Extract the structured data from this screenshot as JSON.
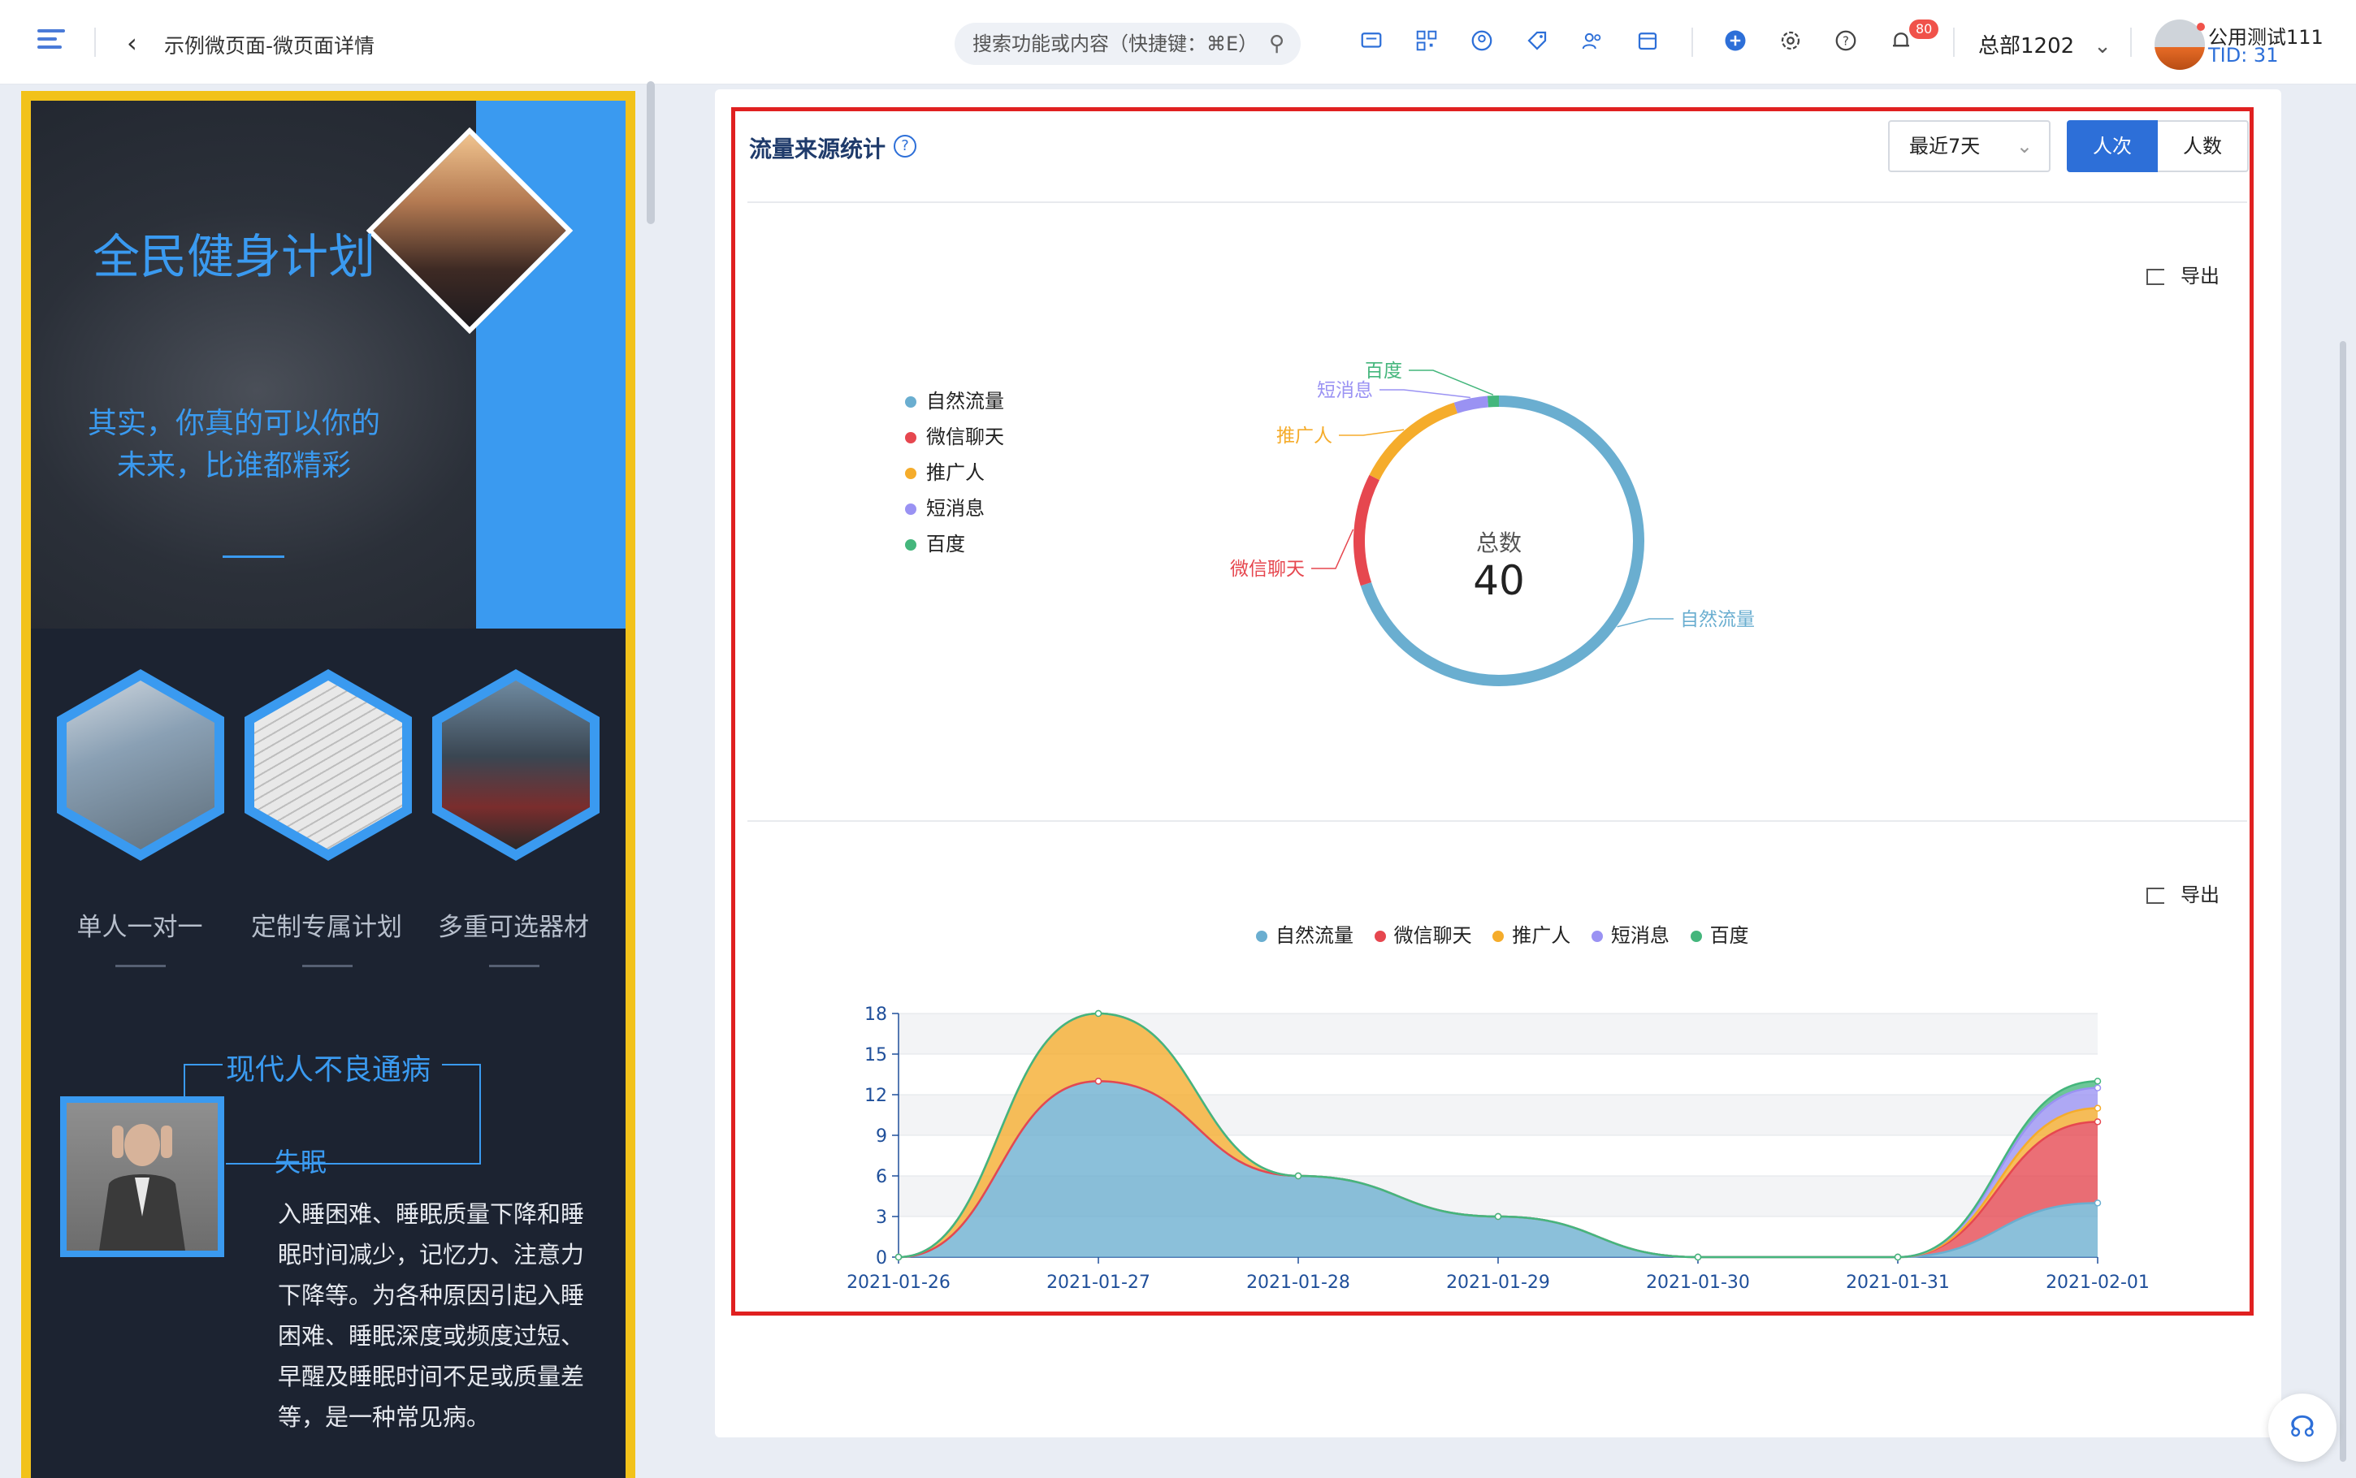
{
  "header": {
    "breadcrumb": "示例微页面-微页面详情",
    "search_placeholder": "搜索功能或内容（快捷键：⌘E）",
    "notification_count": "80",
    "org_selector": "总部1202",
    "user_name": "公用测试111",
    "user_tid": "TID: 31"
  },
  "preview": {
    "hero_title": "全民健身计划",
    "hero_subtitle": "其实，你真的可以你的未来，比谁都精彩",
    "features": [
      "单人一对一",
      "定制专属计划",
      "多重可选器材"
    ],
    "section_title": "现代人不良通病",
    "insomnia_label": "失眠",
    "insomnia_text": "入睡困难、睡眠质量下降和睡眠时间减少，记忆力、注意力下降等。为各种原因引起入睡困难、睡眠深度或频度过短、早醒及睡眠时间不足或质量差等，是一种常见病。"
  },
  "panel": {
    "title": "流量来源统计",
    "range_select": "最近7天",
    "toggle_visits": "人次",
    "toggle_people": "人数",
    "export_label": "导出"
  },
  "colors": {
    "natural": "#6aaed0",
    "wechat": "#e6474f",
    "promoter": "#f5ac2b",
    "sms": "#9a92f3",
    "baidu": "#44b67c",
    "accent": "#2d6fd8",
    "highlight": "#e02020"
  },
  "chart_data": [
    {
      "type": "pie",
      "variant": "donut",
      "center_label": "总数",
      "center_value": "40",
      "legend": [
        "自然流量",
        "微信聊天",
        "推广人",
        "短消息",
        "百度"
      ],
      "slices": [
        {
          "name": "自然流量",
          "value": 28
        },
        {
          "name": "微信聊天",
          "value": 5
        },
        {
          "name": "推广人",
          "value": 5
        },
        {
          "name": "短消息",
          "value": 1.5
        },
        {
          "name": "百度",
          "value": 0.5
        }
      ],
      "legend_position": "left"
    },
    {
      "type": "area",
      "stacked": true,
      "x": [
        "2021-01-26",
        "2021-01-27",
        "2021-01-28",
        "2021-01-29",
        "2021-01-30",
        "2021-01-31",
        "2021-02-01"
      ],
      "y_ticks": [
        "0",
        "3",
        "6",
        "9",
        "12",
        "15",
        "18"
      ],
      "ylim": [
        0,
        18
      ],
      "legend_position": "top",
      "series": [
        {
          "name": "自然流量",
          "values": [
            0,
            13,
            6,
            3,
            0,
            0,
            4
          ]
        },
        {
          "name": "微信聊天",
          "values": [
            0,
            0,
            0,
            0,
            0,
            0,
            6
          ]
        },
        {
          "name": "推广人",
          "values": [
            0,
            5,
            0,
            0,
            0,
            0,
            1
          ]
        },
        {
          "name": "短消息",
          "values": [
            0,
            0,
            0,
            0,
            0,
            0,
            1.5
          ]
        },
        {
          "name": "百度",
          "values": [
            0,
            0,
            0,
            0,
            0,
            0,
            0.5
          ]
        }
      ]
    }
  ]
}
